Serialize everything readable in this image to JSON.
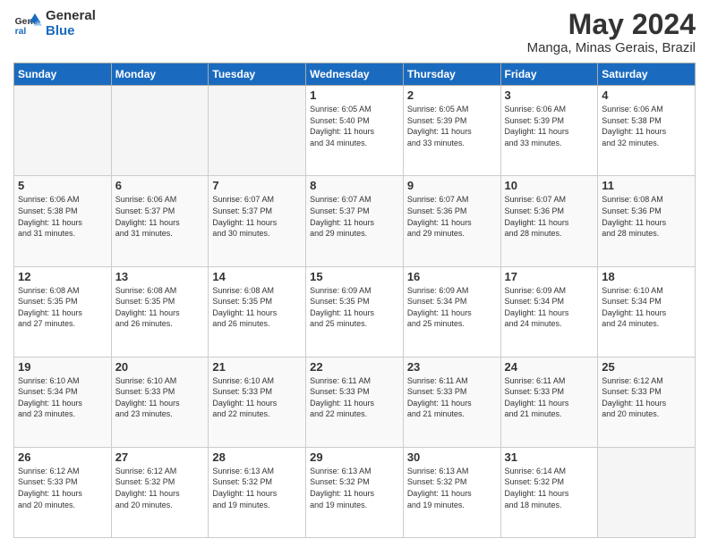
{
  "header": {
    "logo_line1": "General",
    "logo_line2": "Blue",
    "month_title": "May 2024",
    "location": "Manga, Minas Gerais, Brazil"
  },
  "weekdays": [
    "Sunday",
    "Monday",
    "Tuesday",
    "Wednesday",
    "Thursday",
    "Friday",
    "Saturday"
  ],
  "weeks": [
    [
      {
        "day": "",
        "info": ""
      },
      {
        "day": "",
        "info": ""
      },
      {
        "day": "",
        "info": ""
      },
      {
        "day": "1",
        "info": "Sunrise: 6:05 AM\nSunset: 5:40 PM\nDaylight: 11 hours\nand 34 minutes."
      },
      {
        "day": "2",
        "info": "Sunrise: 6:05 AM\nSunset: 5:39 PM\nDaylight: 11 hours\nand 33 minutes."
      },
      {
        "day": "3",
        "info": "Sunrise: 6:06 AM\nSunset: 5:39 PM\nDaylight: 11 hours\nand 33 minutes."
      },
      {
        "day": "4",
        "info": "Sunrise: 6:06 AM\nSunset: 5:38 PM\nDaylight: 11 hours\nand 32 minutes."
      }
    ],
    [
      {
        "day": "5",
        "info": "Sunrise: 6:06 AM\nSunset: 5:38 PM\nDaylight: 11 hours\nand 31 minutes."
      },
      {
        "day": "6",
        "info": "Sunrise: 6:06 AM\nSunset: 5:37 PM\nDaylight: 11 hours\nand 31 minutes."
      },
      {
        "day": "7",
        "info": "Sunrise: 6:07 AM\nSunset: 5:37 PM\nDaylight: 11 hours\nand 30 minutes."
      },
      {
        "day": "8",
        "info": "Sunrise: 6:07 AM\nSunset: 5:37 PM\nDaylight: 11 hours\nand 29 minutes."
      },
      {
        "day": "9",
        "info": "Sunrise: 6:07 AM\nSunset: 5:36 PM\nDaylight: 11 hours\nand 29 minutes."
      },
      {
        "day": "10",
        "info": "Sunrise: 6:07 AM\nSunset: 5:36 PM\nDaylight: 11 hours\nand 28 minutes."
      },
      {
        "day": "11",
        "info": "Sunrise: 6:08 AM\nSunset: 5:36 PM\nDaylight: 11 hours\nand 28 minutes."
      }
    ],
    [
      {
        "day": "12",
        "info": "Sunrise: 6:08 AM\nSunset: 5:35 PM\nDaylight: 11 hours\nand 27 minutes."
      },
      {
        "day": "13",
        "info": "Sunrise: 6:08 AM\nSunset: 5:35 PM\nDaylight: 11 hours\nand 26 minutes."
      },
      {
        "day": "14",
        "info": "Sunrise: 6:08 AM\nSunset: 5:35 PM\nDaylight: 11 hours\nand 26 minutes."
      },
      {
        "day": "15",
        "info": "Sunrise: 6:09 AM\nSunset: 5:35 PM\nDaylight: 11 hours\nand 25 minutes."
      },
      {
        "day": "16",
        "info": "Sunrise: 6:09 AM\nSunset: 5:34 PM\nDaylight: 11 hours\nand 25 minutes."
      },
      {
        "day": "17",
        "info": "Sunrise: 6:09 AM\nSunset: 5:34 PM\nDaylight: 11 hours\nand 24 minutes."
      },
      {
        "day": "18",
        "info": "Sunrise: 6:10 AM\nSunset: 5:34 PM\nDaylight: 11 hours\nand 24 minutes."
      }
    ],
    [
      {
        "day": "19",
        "info": "Sunrise: 6:10 AM\nSunset: 5:34 PM\nDaylight: 11 hours\nand 23 minutes."
      },
      {
        "day": "20",
        "info": "Sunrise: 6:10 AM\nSunset: 5:33 PM\nDaylight: 11 hours\nand 23 minutes."
      },
      {
        "day": "21",
        "info": "Sunrise: 6:10 AM\nSunset: 5:33 PM\nDaylight: 11 hours\nand 22 minutes."
      },
      {
        "day": "22",
        "info": "Sunrise: 6:11 AM\nSunset: 5:33 PM\nDaylight: 11 hours\nand 22 minutes."
      },
      {
        "day": "23",
        "info": "Sunrise: 6:11 AM\nSunset: 5:33 PM\nDaylight: 11 hours\nand 21 minutes."
      },
      {
        "day": "24",
        "info": "Sunrise: 6:11 AM\nSunset: 5:33 PM\nDaylight: 11 hours\nand 21 minutes."
      },
      {
        "day": "25",
        "info": "Sunrise: 6:12 AM\nSunset: 5:33 PM\nDaylight: 11 hours\nand 20 minutes."
      }
    ],
    [
      {
        "day": "26",
        "info": "Sunrise: 6:12 AM\nSunset: 5:33 PM\nDaylight: 11 hours\nand 20 minutes."
      },
      {
        "day": "27",
        "info": "Sunrise: 6:12 AM\nSunset: 5:32 PM\nDaylight: 11 hours\nand 20 minutes."
      },
      {
        "day": "28",
        "info": "Sunrise: 6:13 AM\nSunset: 5:32 PM\nDaylight: 11 hours\nand 19 minutes."
      },
      {
        "day": "29",
        "info": "Sunrise: 6:13 AM\nSunset: 5:32 PM\nDaylight: 11 hours\nand 19 minutes."
      },
      {
        "day": "30",
        "info": "Sunrise: 6:13 AM\nSunset: 5:32 PM\nDaylight: 11 hours\nand 19 minutes."
      },
      {
        "day": "31",
        "info": "Sunrise: 6:14 AM\nSunset: 5:32 PM\nDaylight: 11 hours\nand 18 minutes."
      },
      {
        "day": "",
        "info": ""
      }
    ]
  ]
}
